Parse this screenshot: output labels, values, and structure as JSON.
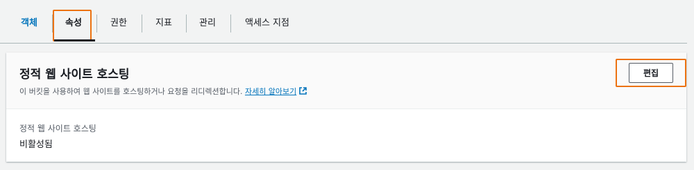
{
  "tabs": [
    {
      "label": "객체",
      "active": false
    },
    {
      "label": "속성",
      "active": true
    },
    {
      "label": "권한",
      "active": false
    },
    {
      "label": "지표",
      "active": false
    },
    {
      "label": "관리",
      "active": false
    },
    {
      "label": "액세스 지점",
      "active": false
    }
  ],
  "panel": {
    "title": "정적 웹 사이트 호스팅",
    "description": "이 버킷을 사용하여 웹 사이트를 호스팅하거나 요청을 리디렉션합니다.",
    "learn_more": "자세히 알아보기",
    "edit_label": "편집",
    "field_label": "정적 웹 사이트 호스팅",
    "field_value": "비활성됨"
  },
  "colors": {
    "accent": "#0073bb",
    "highlight": "#ec7211"
  },
  "icons": {
    "learn_more": "external-link-icon"
  }
}
